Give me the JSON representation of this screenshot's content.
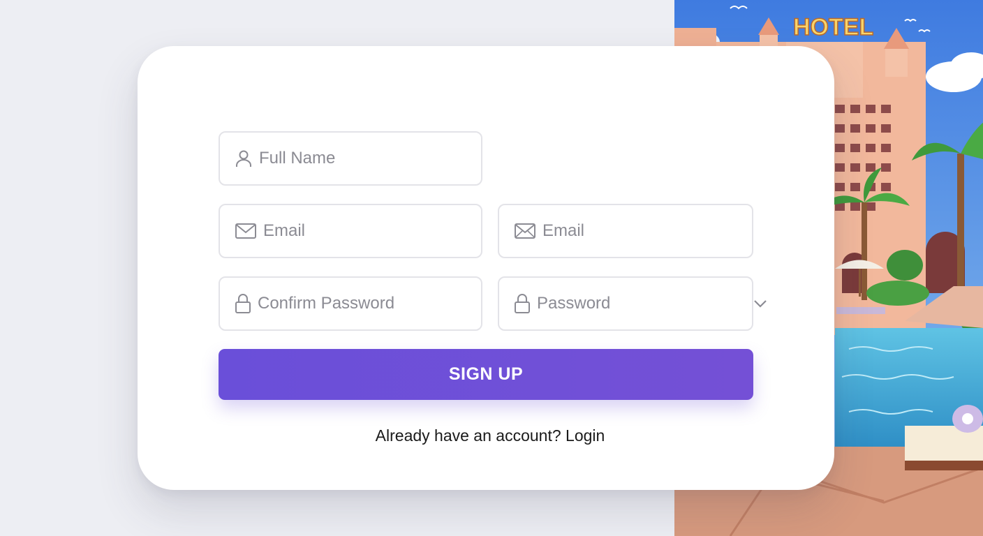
{
  "illustration": {
    "sign_text": "HOTEL"
  },
  "form": {
    "full_name": {
      "placeholder": "Full Name",
      "icon": "user-icon"
    },
    "email": {
      "placeholder": "Email",
      "icon": "mail-icon"
    },
    "email_secondary": {
      "placeholder": "Email",
      "icon": "mail-icon"
    },
    "confirm_password": {
      "placeholder": "Confirm Password",
      "icon": "lock-icon"
    },
    "password": {
      "placeholder": "Password",
      "icon": "lock-icon",
      "trailing_icon": "chevron-down-icon"
    },
    "submit_label": "SIGN UP",
    "footer_text": "Already have an account?",
    "login_link": "Login"
  },
  "colors": {
    "primary": "#6d4fd8",
    "background": "#edeef3",
    "card": "#ffffff",
    "field_border": "#e3e3e8",
    "placeholder": "#8b8b93"
  }
}
